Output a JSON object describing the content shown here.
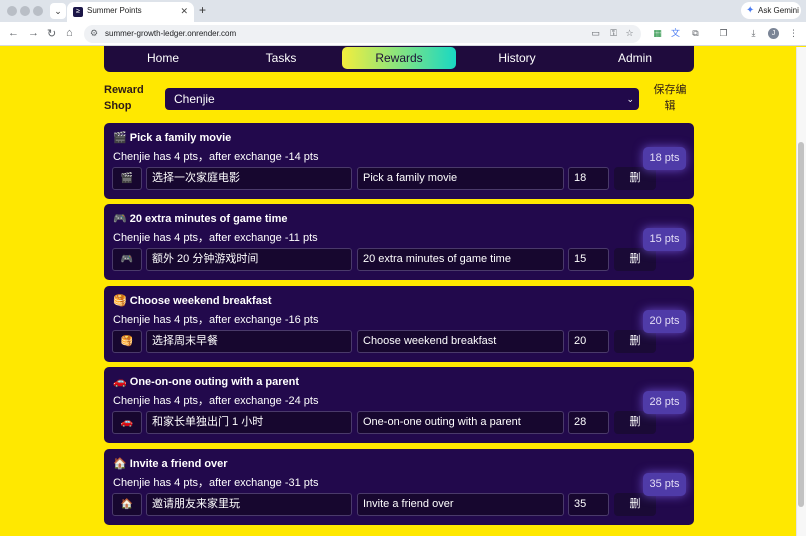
{
  "browser": {
    "tab_title": "Summer Points",
    "url": "summer-growth-ledger.onrender.com",
    "ask_gemini": "Ask Gemini",
    "profile_initial": "J"
  },
  "nav": {
    "items": [
      "Home",
      "Tasks",
      "Rewards",
      "History",
      "Admin"
    ],
    "active": "Rewards"
  },
  "shop": {
    "label_line1": "Reward",
    "label_line2": "Shop",
    "selected_user": "Chenjie",
    "save_line1": "保存编",
    "save_line2": "辑"
  },
  "rewards": [
    {
      "emoji": "🎬",
      "title": "Pick a family movie",
      "subtitle": "Chenjie has 4 pts，after exchange -14 pts",
      "zh": "选择一次家庭电影",
      "en": "Pick a family movie",
      "points": "18",
      "badge": "18 pts",
      "delete_label": "删"
    },
    {
      "emoji": "🎮",
      "title": "20 extra minutes of game time",
      "subtitle": "Chenjie has 4 pts，after exchange -11 pts",
      "zh": "额外 20 分钟游戏时间",
      "en": "20 extra minutes of game time",
      "points": "15",
      "badge": "15 pts",
      "delete_label": "删"
    },
    {
      "emoji": "🥞",
      "title": "Choose weekend breakfast",
      "subtitle": "Chenjie has 4 pts，after exchange -16 pts",
      "zh": "选择周末早餐",
      "en": "Choose weekend breakfast",
      "points": "20",
      "badge": "20 pts",
      "delete_label": "删"
    },
    {
      "emoji": "🚗",
      "title": "One-on-one outing with a parent",
      "subtitle": "Chenjie has 4 pts，after exchange -24 pts",
      "zh": "和家长单独出门 1 小时",
      "en": "One-on-one outing with a parent",
      "points": "28",
      "badge": "28 pts",
      "delete_label": "删"
    },
    {
      "emoji": "🏠",
      "title": "Invite a friend over",
      "subtitle": "Chenjie has 4 pts，after exchange -31 pts",
      "zh": "邀请朋友来家里玩",
      "en": "Invite a friend over",
      "points": "35",
      "badge": "35 pts",
      "delete_label": "删"
    }
  ]
}
